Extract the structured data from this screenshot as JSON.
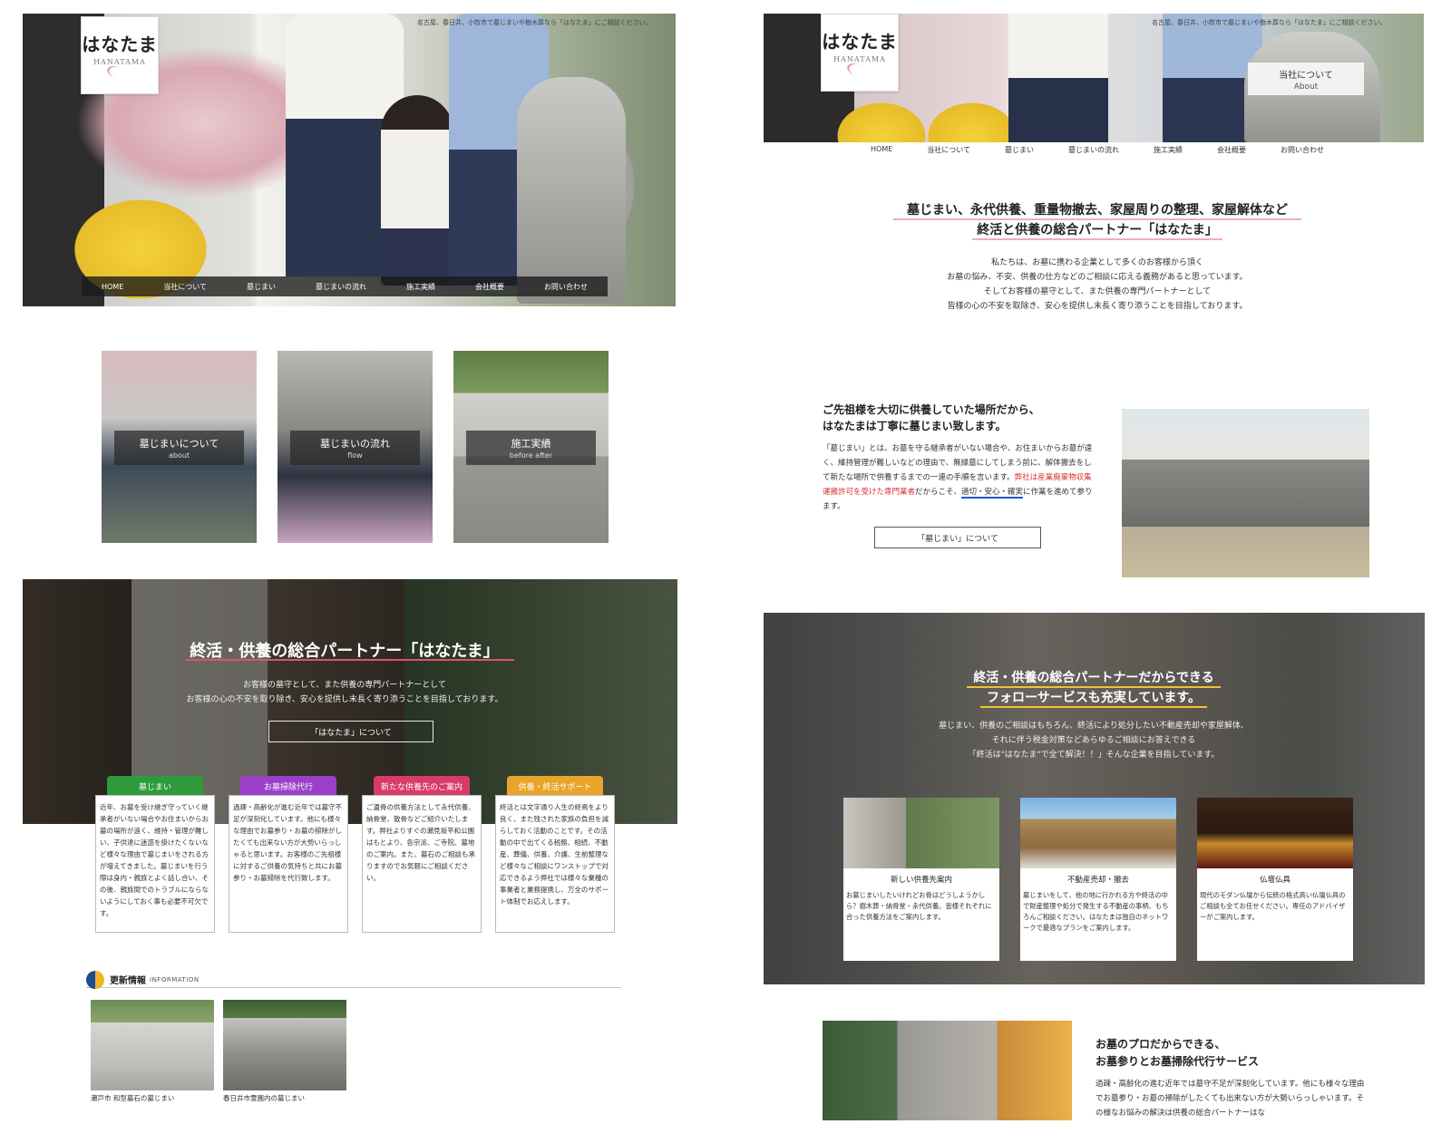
{
  "left": {
    "logo": {
      "jp": "はなたま",
      "en": "HANATAMA"
    },
    "tagline": "名古屋、春日井、小牧市で墓じまいや樹木葬なら「はなたま」にご相談ください。",
    "nav": [
      "HOME",
      "当社について",
      "墓じまい",
      "墓じまいの流れ",
      "施工実績",
      "会社概要",
      "お問い合わせ"
    ],
    "cards": [
      {
        "title": "墓じまいについて",
        "sub": "about"
      },
      {
        "title": "墓じまいの流れ",
        "sub": "flow"
      },
      {
        "title": "施工実績",
        "sub": "before after"
      }
    ],
    "partner": {
      "title": "終活・供養の総合パートナー「はなたま」",
      "lead1": "お客様の墓守として、また供養の専門パートナーとして",
      "lead2": "お客様の心の不安を取り除き、安心を提供し末長く寄り添うことを目指しております。",
      "button": "「はなたま」について"
    },
    "services": [
      {
        "label": "墓じまい",
        "color": "#2e9b3a",
        "text": "近年、お墓を受け継ぎ守っていく継承者がいない場合やお住まいからお墓の場所が遠く、維持・管理が難しい、子供達に迷惑を掛けたくないなど様々な理由で墓じまいをされる方が増えてきました。墓じまいを行う際は身内・親族とよく話し合い、その後、親族間でのトラブルにならないようにしておく事も必要不可欠です。"
      },
      {
        "label": "お墓掃除代行",
        "color": "#9b3fc9",
        "text": "過疎・高齢化が進む近年では墓守不足が深刻化しています。他にも様々な理由でお墓参り・お墓の掃除がしたくても出来ない方が大勢いらっしゃると思います。お客様のご先祖様に対するご供養の気持ちと共にお墓参り・お墓掃除を代行致します。"
      },
      {
        "label": "新たな供養先のご案内",
        "color": "#d83a6a",
        "text": "ご遺骨の供養方法として永代供養、納骨堂、散骨などご紹介いたします。弊社よりすぐの瀬見坂平和公園はもとより、各宗派、ご寺院、墓地のご案内。また、墓石のご相談も承りますのでお気軽にご相談ください。"
      },
      {
        "label": "供養・終活サポート",
        "color": "#e8a52a",
        "text": "終活とは文字通り人生の終焉をより良く、また残された家族の負担を減らしておく活動のことです。その活動の中で出てくる税務、相続、不動産、葬儀、供養、介護、生前整理など様々なご相談にワンストップで対応できるよう弊社では様々な業種の事業者と業務提携し、万全のサポート体制でお応えします。"
      }
    ],
    "info": {
      "title": "更新情報",
      "en": "INFORMATION"
    },
    "posts": [
      {
        "caption": "瀬戸市 和型墓石の墓じまい"
      },
      {
        "caption": "春日井市霊園内の墓じまい"
      }
    ]
  },
  "right": {
    "logo": {
      "jp": "はなたま",
      "en": "HANATAMA"
    },
    "tagline": "名古屋、春日井、小牧市で墓じまいや樹木葬なら「はなたま」にご相談ください。",
    "about_pop": {
      "jp": "当社について",
      "en": "About"
    },
    "nav": [
      "HOME",
      "当社について",
      "墓じまい",
      "墓じまいの流れ",
      "施工実績",
      "会社概要",
      "お問い合わせ"
    ],
    "headline1": "墓じまい、永代供養、重量物撤去、家屋周りの整理、家屋解体など",
    "headline2": "終活と供養の総合パートナー「はなたま」",
    "intro": [
      "私たちは、お墓に携わる企業として多くのお客様から頂く",
      "お墓の悩み、不安、供養の仕方などのご相談に応える義務があると思っています。",
      "そしてお客様の墓守として、また供養の専門パートナーとして",
      "皆様の心の不安を取除き、安心を提供し末長く寄り添うことを目指しております。"
    ],
    "ancestor": {
      "title1": "ご先祖様を大切に供養していた場所だから、",
      "title2": "はなたまは丁寧に墓じまい致します。",
      "body_a": "「墓じまい」とは、お墓を守る継承者がいない場合や、お住まいからお墓が遠く、維持管理が難しいなどの理由で、無縁墓にしてしまう前に、解体撤去をして新たな場所で供養するまでの一連の手順を言います。",
      "body_red": "弊社は産業廃棄物収集運搬許可を受けた専門業者",
      "body_b": "だからこそ、",
      "body_blue": "適切・安心・確実",
      "body_c": "に作業を進めて参ります。",
      "button": "「墓じまい」について"
    },
    "follow": {
      "title1": "終活・供養の総合パートナーだからできる",
      "title2": "フォローサービスも充実しています。",
      "lead": [
        "墓じまい、供養のご相談はもちろん、終活により処分したい不動産売却や家屋解体、",
        "それに伴う税金対策などあらゆるご相談にお答えできる",
        "「終活は\"はなたま\"で全て解決！！」そんな企業を目指しています。"
      ],
      "cards": [
        {
          "name": "新しい供養先案内",
          "desc": "お墓じまいしたいけれどお骨はどうしようかしら？樹木葬・納骨堂・永代供養。皆様それぞれに合った供養方法をご案内します。"
        },
        {
          "name": "不動産売却・撤去",
          "desc": "墓じまいをして、他の地に行かれる方や終活の中で財産整理や処分で発生する不動産の事柄、もちろんご相談ください。はなたまは独自のネットワークで最適なプランをご案内します。"
        },
        {
          "name": "仏壇仏具",
          "desc": "現代のモダン仏壇から伝統の格式高い仏壇仏具のご相談も全てお任せください。専任のアドバイザーがご案内します。"
        }
      ]
    },
    "cleaning": {
      "title1": "お墓のプロだからできる、",
      "title2": "お墓参りとお墓掃除代行サービス",
      "body": "過疎・高齢化の進む近年では墓守不足が深刻化しています。他にも様々な理由でお墓参り・お墓の掃除がしたくても出来ない方が大勢いらっしゃいます。その様なお悩みの解決は供養の総合パートナーはな"
    }
  }
}
